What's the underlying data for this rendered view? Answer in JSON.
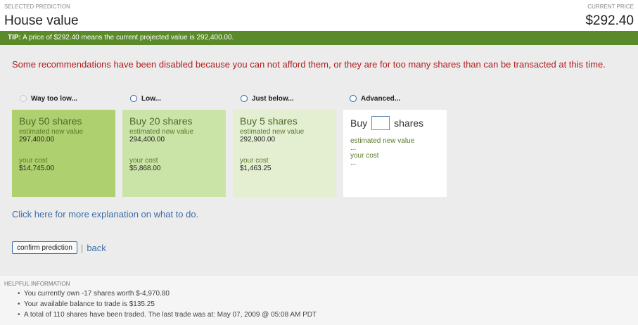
{
  "header": {
    "selected_label": "SELECTED PREDICTION",
    "title": "House value",
    "price_label": "CURRENT PRICE",
    "price": "$292.40"
  },
  "tip": {
    "prefix": "TIP:",
    "text": "A price of $292.40 means the current projected value is 292,400.00."
  },
  "warning": "Some recommendations have been disabled because you can not afford them, or they are for too many shares than can be transacted at this time.",
  "options": [
    {
      "label": "Way too low...",
      "enabled": false
    },
    {
      "label": "Low...",
      "enabled": true
    },
    {
      "label": "Just below...",
      "enabled": true
    },
    {
      "label": "Advanced...",
      "enabled": true
    }
  ],
  "cards": [
    {
      "buy": "Buy 50 shares",
      "est_label": "estimated new value",
      "est_value": "297,400.00",
      "cost_label": "your cost",
      "cost_value": "$14,745.00"
    },
    {
      "buy": "Buy 20 shares",
      "est_label": "estimated new value",
      "est_value": "294,400.00",
      "cost_label": "your cost",
      "cost_value": "$5,868.00"
    },
    {
      "buy": "Buy 5 shares",
      "est_label": "estimated new value",
      "est_value": "292,900.00",
      "cost_label": "your cost",
      "cost_value": "$1,463.25"
    }
  ],
  "advanced": {
    "buy_label": "Buy",
    "shares_label": "shares",
    "input_value": "",
    "est_label": "estimated new value",
    "est_value": "...",
    "cost_label": "your cost",
    "cost_value": "..."
  },
  "explain_link": "Click here for more explanation on what to do.",
  "actions": {
    "confirm": "confirm prediction",
    "separator": "|",
    "back": "back"
  },
  "help": {
    "title": "HELPFUL INFORMATION",
    "items": [
      "You currently own -17 shares worth $-4,970.80",
      "Your available balance to trade is $135.25",
      "A total of 110 shares have been traded. The last trade was at: May 07, 2009 @ 05:08 AM PDT"
    ]
  },
  "colors": {
    "tip_bg": "#5a8a29",
    "warning_text": "#b21d1d",
    "link": "#3d6ea8",
    "card1": "#afd06f",
    "card2": "#cae3a6",
    "card3": "#e3efd0"
  }
}
